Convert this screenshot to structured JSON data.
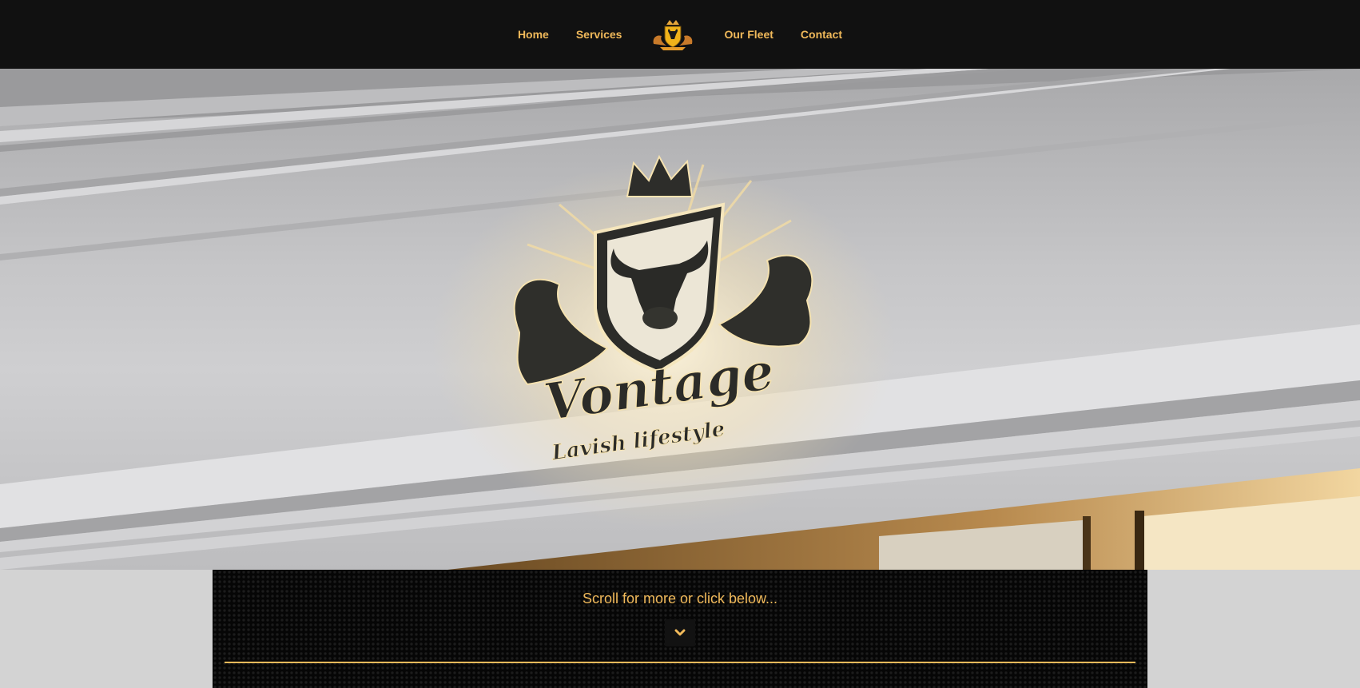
{
  "nav": {
    "items_left": [
      {
        "label": "Home"
      },
      {
        "label": "Services"
      }
    ],
    "items_right": [
      {
        "label": "Our Fleet"
      },
      {
        "label": "Contact"
      }
    ],
    "logo_icon": "bull-crest-logo-icon"
  },
  "hero": {
    "sign_brand": "Vontage",
    "sign_tagline": "Lavish lifestyle"
  },
  "panel": {
    "scroll_text": "Scroll for more or click below...",
    "button_icon": "chevron-down-icon"
  },
  "colors": {
    "accent": "#f0b95a",
    "nav_bg": "#111111",
    "page_bg": "#d3d3d3",
    "panel_bg": "#060606"
  }
}
